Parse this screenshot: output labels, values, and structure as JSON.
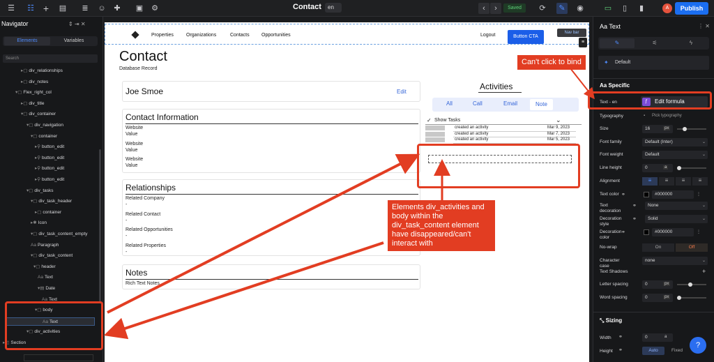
{
  "topbar": {
    "page_title": "Contact",
    "lang": "en",
    "saved": "Saved",
    "publish": "Publish",
    "avatar": "A"
  },
  "navigator": {
    "title": "Navigator",
    "tab_elements": "Elements",
    "tab_variables": "Variables",
    "search_placeholder": "Search",
    "items": [
      {
        "label": "div_relationships"
      },
      {
        "label": "div_notes"
      },
      {
        "label": "Flex_right_col"
      },
      {
        "label": "div_title"
      },
      {
        "label": "div_container"
      },
      {
        "label": "div_navigation"
      },
      {
        "label": "container"
      },
      {
        "label": "button_edit"
      },
      {
        "label": "button_edit"
      },
      {
        "label": "button_edit"
      },
      {
        "label": "button_edit"
      },
      {
        "label": "div_tasks"
      },
      {
        "label": "div_task_header"
      },
      {
        "label": "container"
      },
      {
        "label": "Icon"
      },
      {
        "label": "div_task_content_empty"
      },
      {
        "label": "Paragraph"
      },
      {
        "label": "div_task_content"
      },
      {
        "label": "header"
      },
      {
        "label": "Text"
      },
      {
        "label": "Date"
      },
      {
        "label": "Text"
      },
      {
        "label": "body"
      },
      {
        "label": "Text"
      },
      {
        "label": "div_activities"
      },
      {
        "label": "Section"
      }
    ]
  },
  "canvas": {
    "nav": {
      "links": [
        "Properties",
        "Organizations",
        "Contacts",
        "Opportunities"
      ],
      "logout": "Logout",
      "cta": "Button CTA",
      "tag": "Nav bar"
    },
    "heading": "Contact",
    "subheading": "Database Record",
    "name_card": {
      "name": "Joe Smoe",
      "edit": "Edit"
    },
    "contact_info": {
      "title": "Contact Information",
      "fields": [
        [
          "Website",
          "Value"
        ],
        [
          "Website",
          "Value"
        ],
        [
          "Website",
          "Value"
        ]
      ]
    },
    "relationships": {
      "title": "Relationships",
      "fields": [
        [
          "Related Company",
          "-"
        ],
        [
          "Related Contact",
          "-"
        ],
        [
          "Related Opportunities",
          "-"
        ],
        [
          "Related Properties",
          "-"
        ]
      ]
    },
    "notes": {
      "title": "Notes",
      "body": "Rich Text Notes"
    },
    "activities": {
      "title": "Activities",
      "tabs": [
        "All",
        "Call",
        "Email",
        "Note"
      ],
      "show_tasks": "Show Tasks",
      "rows": [
        {
          "text": "created an activity",
          "date": "Mar 9, 2023"
        },
        {
          "text": "created an activity",
          "date": "Mar 7, 2023"
        },
        {
          "text": "created an activity",
          "date": "Mar 5, 2023"
        }
      ]
    }
  },
  "annotations": {
    "bind": "Can't click to bind",
    "main": "Elements div_activities and body within the div_task_content element have disappeared/can't interact with"
  },
  "right": {
    "title": "Text",
    "default": "Default",
    "specific": "Specific",
    "text_en": "Text - en",
    "edit_formula": "Edit formula",
    "rows": [
      {
        "label": "Typography",
        "value": "Pick typography"
      },
      {
        "label": "Size",
        "value": "16",
        "unit": "px"
      },
      {
        "label": "Font family",
        "value": "Default (Inter)"
      },
      {
        "label": "Font weight",
        "value": "Default"
      },
      {
        "label": "Line height",
        "value": "0",
        "unit": "a"
      },
      {
        "label": "Alignment",
        "value": ""
      },
      {
        "label": "Text color",
        "value": "#000000"
      },
      {
        "label": "Text decoration",
        "value": "None"
      },
      {
        "label": "Decoration style",
        "value": "Solid"
      },
      {
        "label": "Decoration color",
        "value": "#000000"
      },
      {
        "label": "No-wrap",
        "value": "On",
        "value2": "Off"
      },
      {
        "label": "Character case",
        "value": "none"
      },
      {
        "label": "Text Shadows",
        "value": ""
      },
      {
        "label": "Letter spacing",
        "value": "0",
        "unit": "px"
      },
      {
        "label": "Word spacing",
        "value": "0",
        "unit": "px"
      }
    ],
    "sizing": "Sizing",
    "width": "Width",
    "width_val": "0",
    "width_unit": "a",
    "height": "Height",
    "auto": "Auto",
    "fixed": "Fixed",
    "help": "?"
  },
  "colors": {
    "accent": "#1b5ee8",
    "annot": "#e23d22"
  }
}
